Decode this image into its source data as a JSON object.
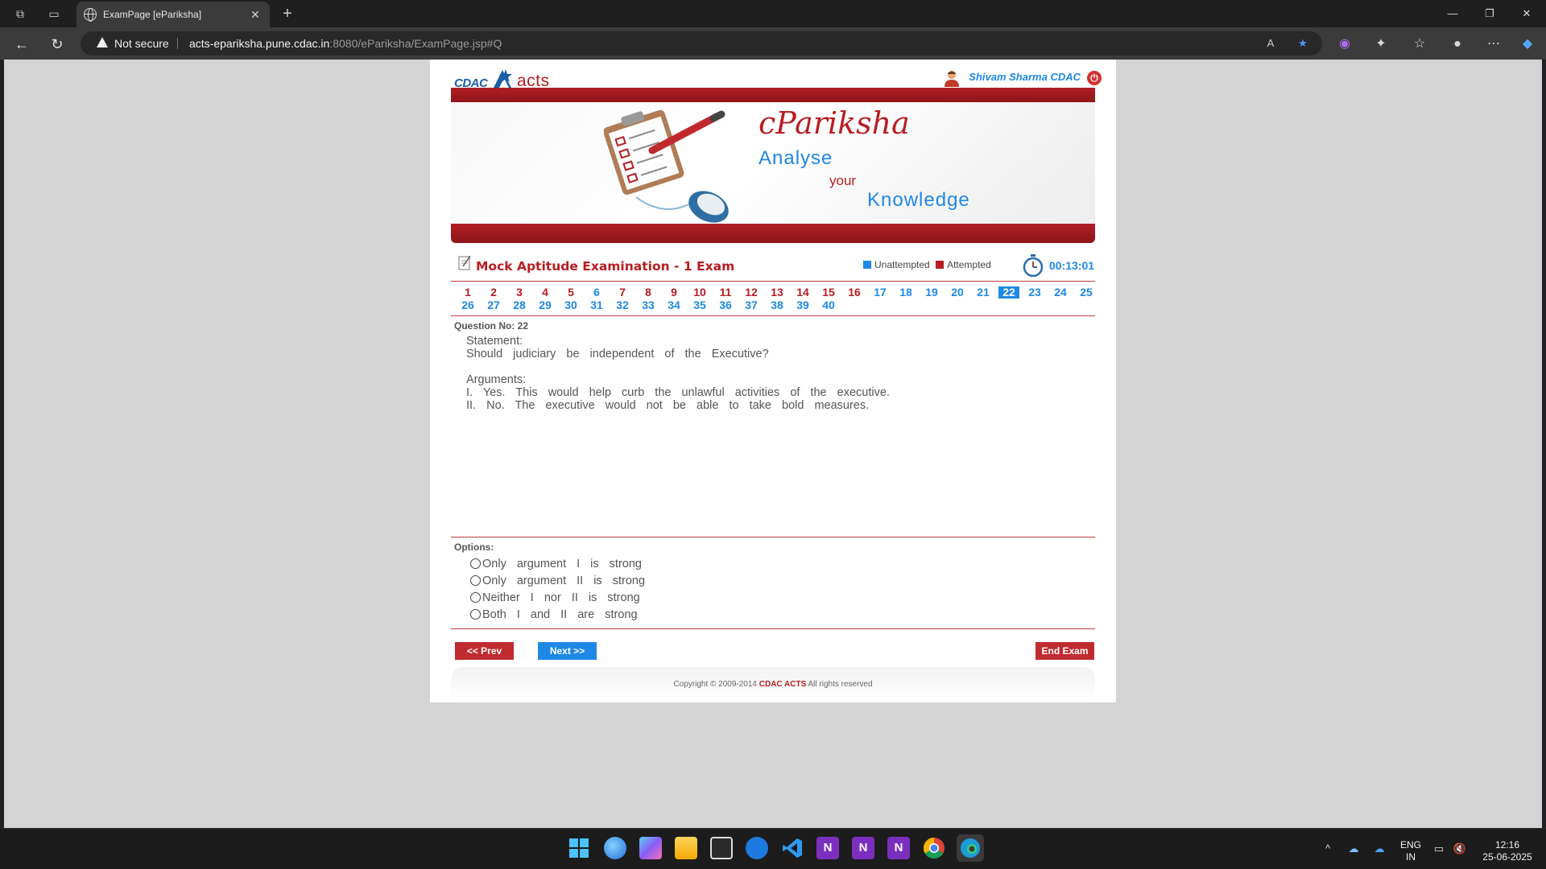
{
  "browser": {
    "tab_title": "ExamPage [ePariksha]",
    "security_label": "Not secure",
    "url_host": "acts-epariksha.pune.cdac.in",
    "url_rest": ":8080/ePariksha/ExamPage.jsp#Q"
  },
  "header": {
    "logo_cdac": "CDAC",
    "logo_acts": "acts",
    "user_name": "Shivam Sharma CDAC"
  },
  "banner": {
    "title": "cPariksha",
    "line1": "Analyse",
    "line2": "your",
    "line3": "Knowledge"
  },
  "exam": {
    "title": "Mock Aptitude Examination - 1 Exam",
    "legend_unattempted": "Unattempted",
    "legend_attempted": "Attempted",
    "timer": "00:13:01",
    "colors": {
      "attempted": "#b81d22",
      "unattempted": "#1e88e5"
    }
  },
  "question_nav": {
    "row1": [
      "1",
      "2",
      "3",
      "4",
      "5",
      "6",
      "7",
      "8",
      "9",
      "10",
      "11",
      "12",
      "13",
      "14",
      "15",
      "16",
      "17",
      "18",
      "19",
      "20",
      "21",
      "22",
      "23",
      "24",
      "25"
    ],
    "row2": [
      "26",
      "27",
      "28",
      "29",
      "30",
      "31",
      "32",
      "33",
      "34",
      "35",
      "36",
      "37",
      "38",
      "39",
      "40"
    ],
    "row1_status": [
      "att",
      "att",
      "att",
      "att",
      "att",
      "un",
      "att",
      "att",
      "att",
      "att",
      "att",
      "att",
      "att",
      "att",
      "att",
      "att",
      "un",
      "un",
      "un",
      "un",
      "un",
      "cur",
      "un",
      "un",
      "un"
    ],
    "row2_status": [
      "un",
      "un",
      "un",
      "un",
      "un",
      "un",
      "un",
      "un",
      "un",
      "un",
      "un",
      "un",
      "un",
      "un",
      "un"
    ],
    "current": "22"
  },
  "question": {
    "number_label": "Question No: 22",
    "statement_label": "Statement:",
    "statement": "Should judiciary be independent of the Executive?",
    "arguments_label": "Arguments:",
    "argument1": "I. Yes. This would help curb the unlawful activities of the executive.",
    "argument2": "II. No. The executive would not be able to take bold measures."
  },
  "options": {
    "label": "Options:",
    "items": [
      "Only argument I is strong",
      "Only argument II is strong",
      "Neither I nor II is strong",
      "Both I and II are strong"
    ]
  },
  "buttons": {
    "prev": "<< Prev",
    "next": "Next >>",
    "end": "End Exam"
  },
  "footer": {
    "copyright": "Copyright © 2009-2014",
    "brand": "CDAC ACTS",
    "rights": "All rights reserved"
  },
  "taskbar": {
    "lang": "ENG",
    "region": "IN",
    "time": "12:16",
    "date": "25-06-2025"
  }
}
